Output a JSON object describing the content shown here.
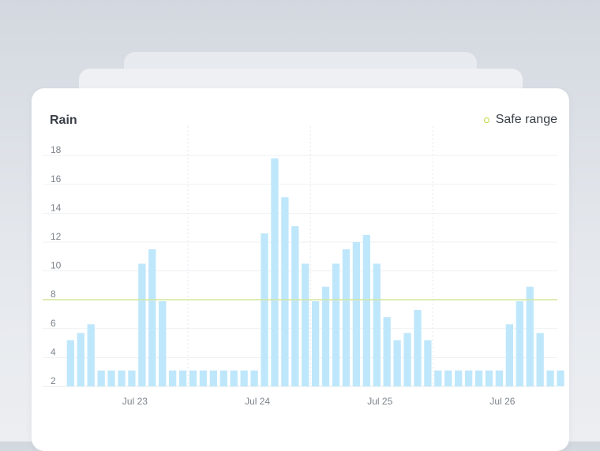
{
  "card": {
    "title": "Rain"
  },
  "legend": {
    "label": "Safe range",
    "color": "#b8db3c"
  },
  "chart_data": {
    "type": "bar",
    "title": "Rain",
    "xlabel": "",
    "ylabel": "",
    "ylim": [
      2,
      19.5
    ],
    "yticks": [
      2,
      4,
      6,
      8,
      10,
      12,
      14,
      16,
      18
    ],
    "grid": true,
    "legend_position": "top-right",
    "bar_color": "#bfe7fb",
    "x_tick_labels": [
      {
        "label": "Jul 23",
        "index": 6
      },
      {
        "label": "Jul 24",
        "index": 18
      },
      {
        "label": "Jul 25",
        "index": 30
      },
      {
        "label": "Jul 26",
        "index": 42
      }
    ],
    "day_separators_after_index": [
      11.5,
      23.5,
      35.5
    ],
    "reference_line": {
      "name": "Safe range",
      "value": 8.0,
      "color": "#d4e6a0"
    },
    "values": [
      5.2,
      5.7,
      6.3,
      3.1,
      3.1,
      3.1,
      3.1,
      10.5,
      11.5,
      7.9,
      3.1,
      3.1,
      3.1,
      3.1,
      3.1,
      3.1,
      3.1,
      3.1,
      3.1,
      12.6,
      17.8,
      15.1,
      13.1,
      10.5,
      7.9,
      8.9,
      10.5,
      11.5,
      12.0,
      12.5,
      10.5,
      6.8,
      5.2,
      5.7,
      7.3,
      5.2,
      3.1,
      3.1,
      3.1,
      3.1,
      3.1,
      3.1,
      3.1,
      6.3,
      7.9,
      8.9,
      5.7,
      3.1,
      3.1
    ]
  }
}
